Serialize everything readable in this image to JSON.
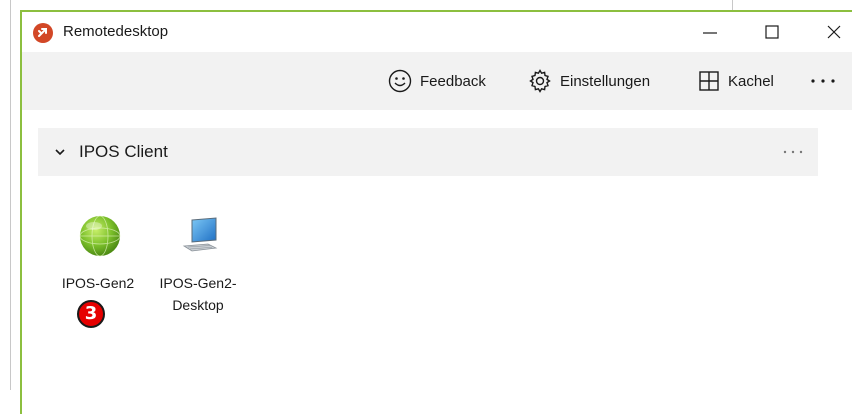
{
  "window": {
    "title": "Remotedesktop",
    "controls": [
      "minimize-icon",
      "maximize-icon",
      "close-icon"
    ]
  },
  "toolbar": {
    "feedback_label": "Feedback",
    "feedback_icon": "smiley-icon",
    "settings_label": "Einstellungen",
    "settings_icon": "gear-icon",
    "view_label": "Kachel",
    "view_icon": "tile-grid-icon",
    "more_icon": "more-icon"
  },
  "group": {
    "title": "IPOS Client",
    "expanded": true,
    "more_icon": "more-icon"
  },
  "tiles": [
    {
      "label": "IPOS-Gen2",
      "icon": "green-globe-icon"
    },
    {
      "label": "IPOS-Gen2-Desktop",
      "icon": "desktop-computer-icon"
    }
  ],
  "annotation": {
    "badge": "3"
  },
  "colors": {
    "accent_border": "#8cbf3f",
    "app_icon": "#d24726",
    "badge": "#e60000",
    "toolbar_bg": "#f2f2f2"
  }
}
